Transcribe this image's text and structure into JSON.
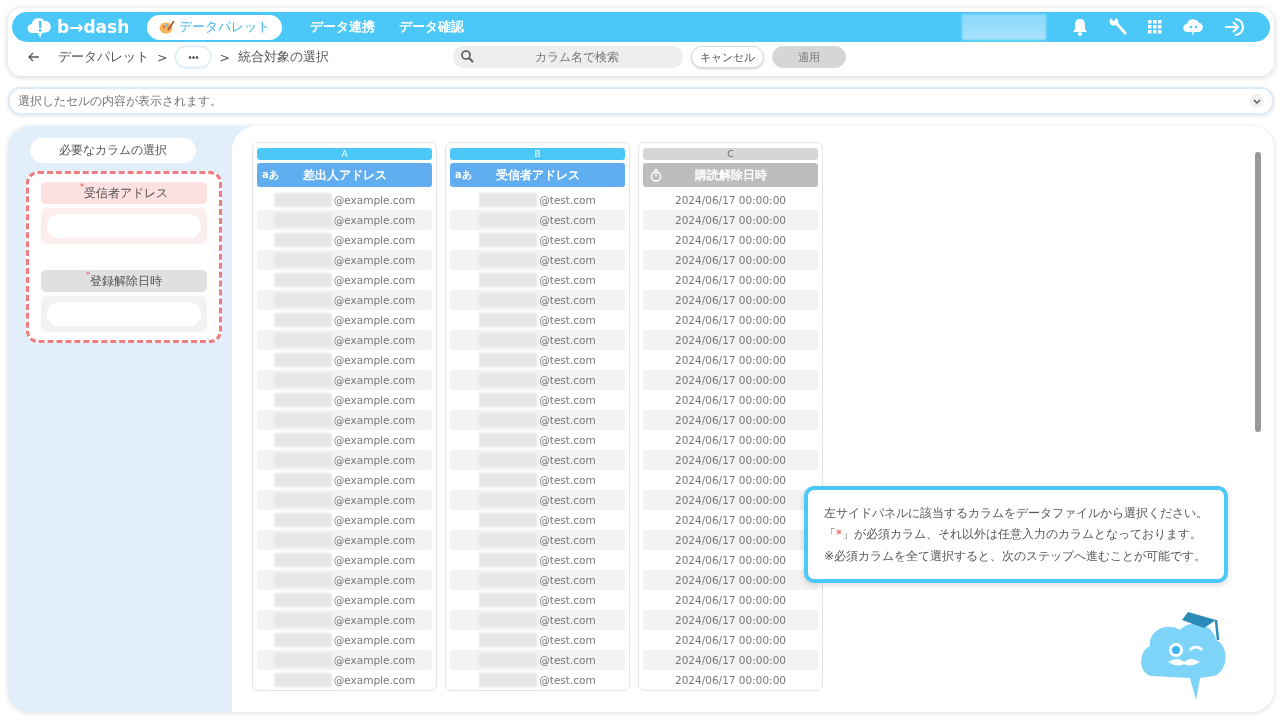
{
  "header": {
    "logo_text": "b→dash",
    "nav": [
      {
        "label": "データパレット",
        "selected": true
      },
      {
        "label": "データ連携",
        "selected": false
      },
      {
        "label": "データ確認",
        "selected": false
      }
    ]
  },
  "toolbar": {
    "breadcrumb": [
      {
        "kind": "link",
        "label": "データパレット"
      },
      {
        "kind": "sep",
        "label": ">"
      },
      {
        "kind": "more",
        "label": "•••"
      },
      {
        "kind": "sep",
        "label": ">"
      },
      {
        "kind": "current",
        "label": "統合対象の選択"
      }
    ],
    "search": {
      "placeholder": "カラム名で検索"
    },
    "buttons": [
      {
        "label": "キャンセル",
        "disabled": false
      },
      {
        "label": "適用",
        "disabled": true
      }
    ]
  },
  "cell_preview": {
    "placeholder": "選択したセルの内容が表示されます。"
  },
  "sidebar": {
    "title": "必要なカラムの選択",
    "fields": [
      {
        "label": "受信者アドレス",
        "mark": "*",
        "selected": true
      },
      {
        "label": "登録解除日時",
        "mark": "*",
        "selected": false
      }
    ]
  },
  "columns": [
    {
      "letter": "A",
      "name": "差出人アドレス",
      "kind": "text",
      "type_label": "aあ",
      "selected": true,
      "redacted": true,
      "rows": [
        "@example.com",
        "@example.com",
        "@example.com",
        "@example.com",
        "@example.com",
        "@example.com",
        "@example.com",
        "@example.com",
        "@example.com",
        "@example.com",
        "@example.com",
        "@example.com",
        "@example.com",
        "@example.com",
        "@example.com",
        "@example.com",
        "@example.com",
        "@example.com",
        "@example.com",
        "@example.com",
        "@example.com",
        "@example.com",
        "@example.com",
        "@example.com",
        "@example.com"
      ]
    },
    {
      "letter": "B",
      "name": "受信者アドレス",
      "kind": "text",
      "type_label": "aあ",
      "selected": true,
      "redacted": true,
      "rows": [
        "@test.com",
        "@test.com",
        "@test.com",
        "@test.com",
        "@test.com",
        "@test.com",
        "@test.com",
        "@test.com",
        "@test.com",
        "@test.com",
        "@test.com",
        "@test.com",
        "@test.com",
        "@test.com",
        "@test.com",
        "@test.com",
        "@test.com",
        "@test.com",
        "@test.com",
        "@test.com",
        "@test.com",
        "@test.com",
        "@test.com",
        "@test.com",
        "@test.com"
      ]
    },
    {
      "letter": "C",
      "name": "購読解除日時",
      "kind": "datetime",
      "selected": false,
      "redacted": false,
      "rows": [
        "2024/06/17 00:00:00",
        "2024/06/17 00:00:00",
        "2024/06/17 00:00:00",
        "2024/06/17 00:00:00",
        "2024/06/17 00:00:00",
        "2024/06/17 00:00:00",
        "2024/06/17 00:00:00",
        "2024/06/17 00:00:00",
        "2024/06/17 00:00:00",
        "2024/06/17 00:00:00",
        "2024/06/17 00:00:00",
        "2024/06/17 00:00:00",
        "2024/06/17 00:00:00",
        "2024/06/17 00:00:00",
        "2024/06/17 00:00:00",
        "2024/06/17 00:00:00",
        "2024/06/17 00:00:00",
        "2024/06/17 00:00:00",
        "2024/06/17 00:00:00",
        "2024/06/17 00:00:00",
        "2024/06/17 00:00:00",
        "2024/06/17 00:00:00",
        "2024/06/17 00:00:00",
        "2024/06/17 00:00:00",
        "2024/06/17 00:00:00"
      ]
    }
  ],
  "tooltip": {
    "line1": "左サイドパネルに該当するカラムをデータファイルから選択ください。",
    "line2": {
      "before": "「",
      "mark": "*",
      "after": "」が必須カラム、それ以外は任意入力のカラムとなっております。"
    },
    "note": "※必須カラムを全て選択すると、次のステップへ進むことが可能です。"
  }
}
